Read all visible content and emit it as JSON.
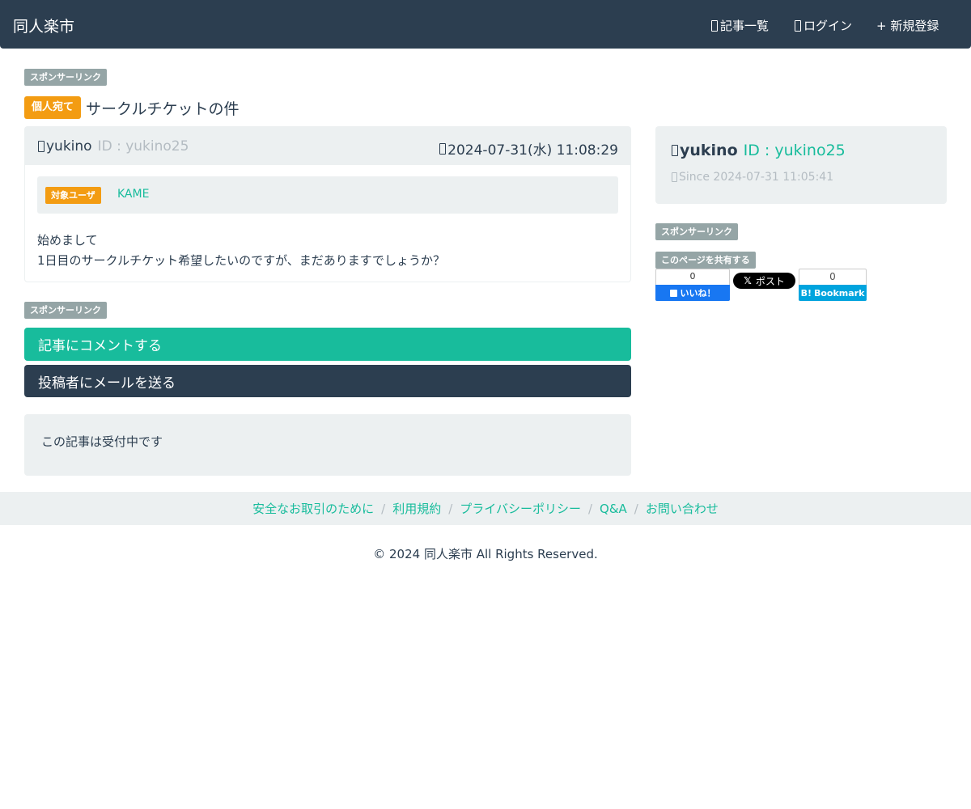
{
  "navbar": {
    "brand": "同人楽市",
    "articles_label": "記事一覧",
    "login_label": "ログイン",
    "register_label": "+ 新規登録"
  },
  "sponsor_label": "スポンサーリンク",
  "article": {
    "category_badge": "個人宛て",
    "title": "サークルチケットの件",
    "author_name": "yukino",
    "author_id": "ID : yukino25",
    "posted_at": "2024-07-31(水) 11:08:29",
    "target_label": "対象ユーザ",
    "target_user": "KAME",
    "body_lines": [
      "始めまして",
      "1日目のサークルチケット希望したいのですが、まだありますでしょうか？"
    ]
  },
  "actions": {
    "comment_label": "記事にコメントする",
    "mail_label": "投稿者にメールを送る"
  },
  "status_text": "この記事は受付中です",
  "profile": {
    "name": "yukino",
    "id": "ID : yukino25",
    "since": "Since 2024-07-31 11:05:41"
  },
  "share": {
    "label": "このページを共有する",
    "facebook_count": "0",
    "facebook_label": "いいね！",
    "x_label": "ポスト",
    "x_logo": "𝕏",
    "hatena_count": "0",
    "hatena_logo": "B!",
    "hatena_label": "Bookmark"
  },
  "footer": {
    "links": [
      "安全なお取引のために",
      "利用規約",
      "プライバシーポリシー",
      "Q&A",
      "お問い合わせ"
    ],
    "separator": "/",
    "copyright": "© 2024 同人楽市 All Rights Reserved."
  },
  "colors": {
    "navbar": "#2c3e50",
    "accent": "#18bc9c",
    "badge_warning": "#f39c12",
    "sponsor_badge": "#95a5a6",
    "well": "#ecf0f1",
    "facebook": "#1877f2",
    "hatena": "#00a4de"
  },
  "icons": {
    "articles": "list-icon",
    "login": "login-icon",
    "author": "user-icon",
    "date": "clock-icon",
    "since": "calendar-icon"
  }
}
